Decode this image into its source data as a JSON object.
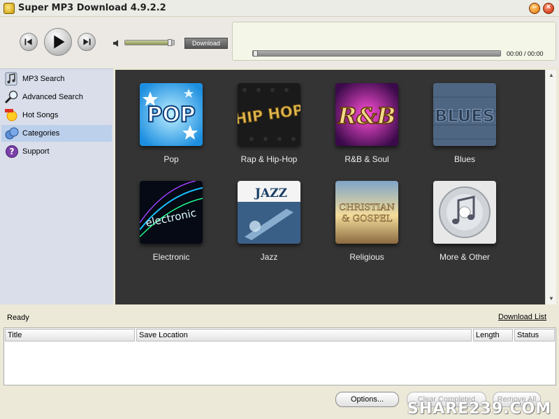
{
  "window": {
    "title": "Super MP3 Download  4.9.2.2",
    "minimize_glyph": "–",
    "close_glyph": "×"
  },
  "player": {
    "download_label": "Download",
    "time": "00:00 / 00:00",
    "volume_level": 0.95,
    "progress_level": 0.0
  },
  "sidebar": {
    "items": [
      {
        "label": "MP3 Search",
        "icon": "music-note-icon"
      },
      {
        "label": "Advanced Search",
        "icon": "magnifier-icon"
      },
      {
        "label": "Hot Songs",
        "icon": "sun-icon"
      },
      {
        "label": "Categories",
        "icon": "categories-icon",
        "active": true
      },
      {
        "label": "Support",
        "icon": "help-icon"
      }
    ]
  },
  "categories": [
    {
      "label": "Pop",
      "art": "POP"
    },
    {
      "label": "Rap & Hip-Hop",
      "art": "HIP HOP"
    },
    {
      "label": "R&B & Soul",
      "art": "R&B"
    },
    {
      "label": "Blues",
      "art": "BLUES"
    },
    {
      "label": "Electronic",
      "art": "electronic"
    },
    {
      "label": "Jazz",
      "art": "JAZZ"
    },
    {
      "label": "Religious",
      "art": "CHRISTIAN & GOSPEL"
    },
    {
      "label": "More & Other",
      "art": ""
    }
  ],
  "status": {
    "text": "Ready",
    "download_list_link": "Download List"
  },
  "download_table": {
    "columns": [
      "Title",
      "Save Location",
      "Length",
      "Status"
    ],
    "rows": []
  },
  "buttons": {
    "options": "Options...",
    "clear_completed": "Clear Completed",
    "remove_all": "Remove All"
  },
  "watermark": "SHARE239.COM",
  "colors": {
    "panel_bg": "#343434",
    "sidebar_bg": "#d9deea",
    "active_item": "#bcd0ec",
    "player_panel": "#f4f6e8"
  }
}
